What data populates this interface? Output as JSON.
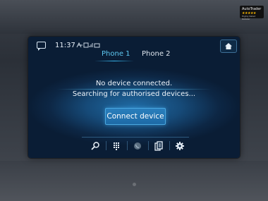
{
  "status_bar": {
    "time": "11:37",
    "icons": [
      "message-icon",
      "route-icon",
      "signal-icon",
      "battery-icon"
    ]
  },
  "tabs": [
    {
      "label": "Phone 1",
      "active": true
    },
    {
      "label": "Phone 2",
      "active": false
    }
  ],
  "main": {
    "line1": "No device connected.",
    "line2": "Searching for authorised devices...",
    "connect_label": "Connect device"
  },
  "dock": [
    "search-icon",
    "keypad-icon",
    "phone-icon",
    "contacts-icon",
    "settings-icon"
  ],
  "colors": {
    "accent": "#37b6ee",
    "active_tab": "#5ec9f2",
    "button": "#1d6aa6"
  },
  "badge": {
    "title": "AutoTrader",
    "stars": "★★★★★",
    "subtitle": "Highly Rated Retailer"
  }
}
